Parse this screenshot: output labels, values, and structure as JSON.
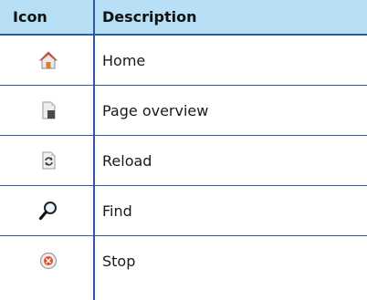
{
  "table": {
    "headers": {
      "icon": "Icon",
      "description": "Description"
    },
    "rows": [
      {
        "icon": "home-icon",
        "description": "Home"
      },
      {
        "icon": "page-overview-icon",
        "description": "Page overview"
      },
      {
        "icon": "reload-icon",
        "description": "Reload"
      },
      {
        "icon": "find-icon",
        "description": "Find"
      },
      {
        "icon": "stop-icon",
        "description": "Stop"
      }
    ]
  },
  "colors": {
    "header_bg": "#b7dff6",
    "rule": "#2c5aa6"
  }
}
